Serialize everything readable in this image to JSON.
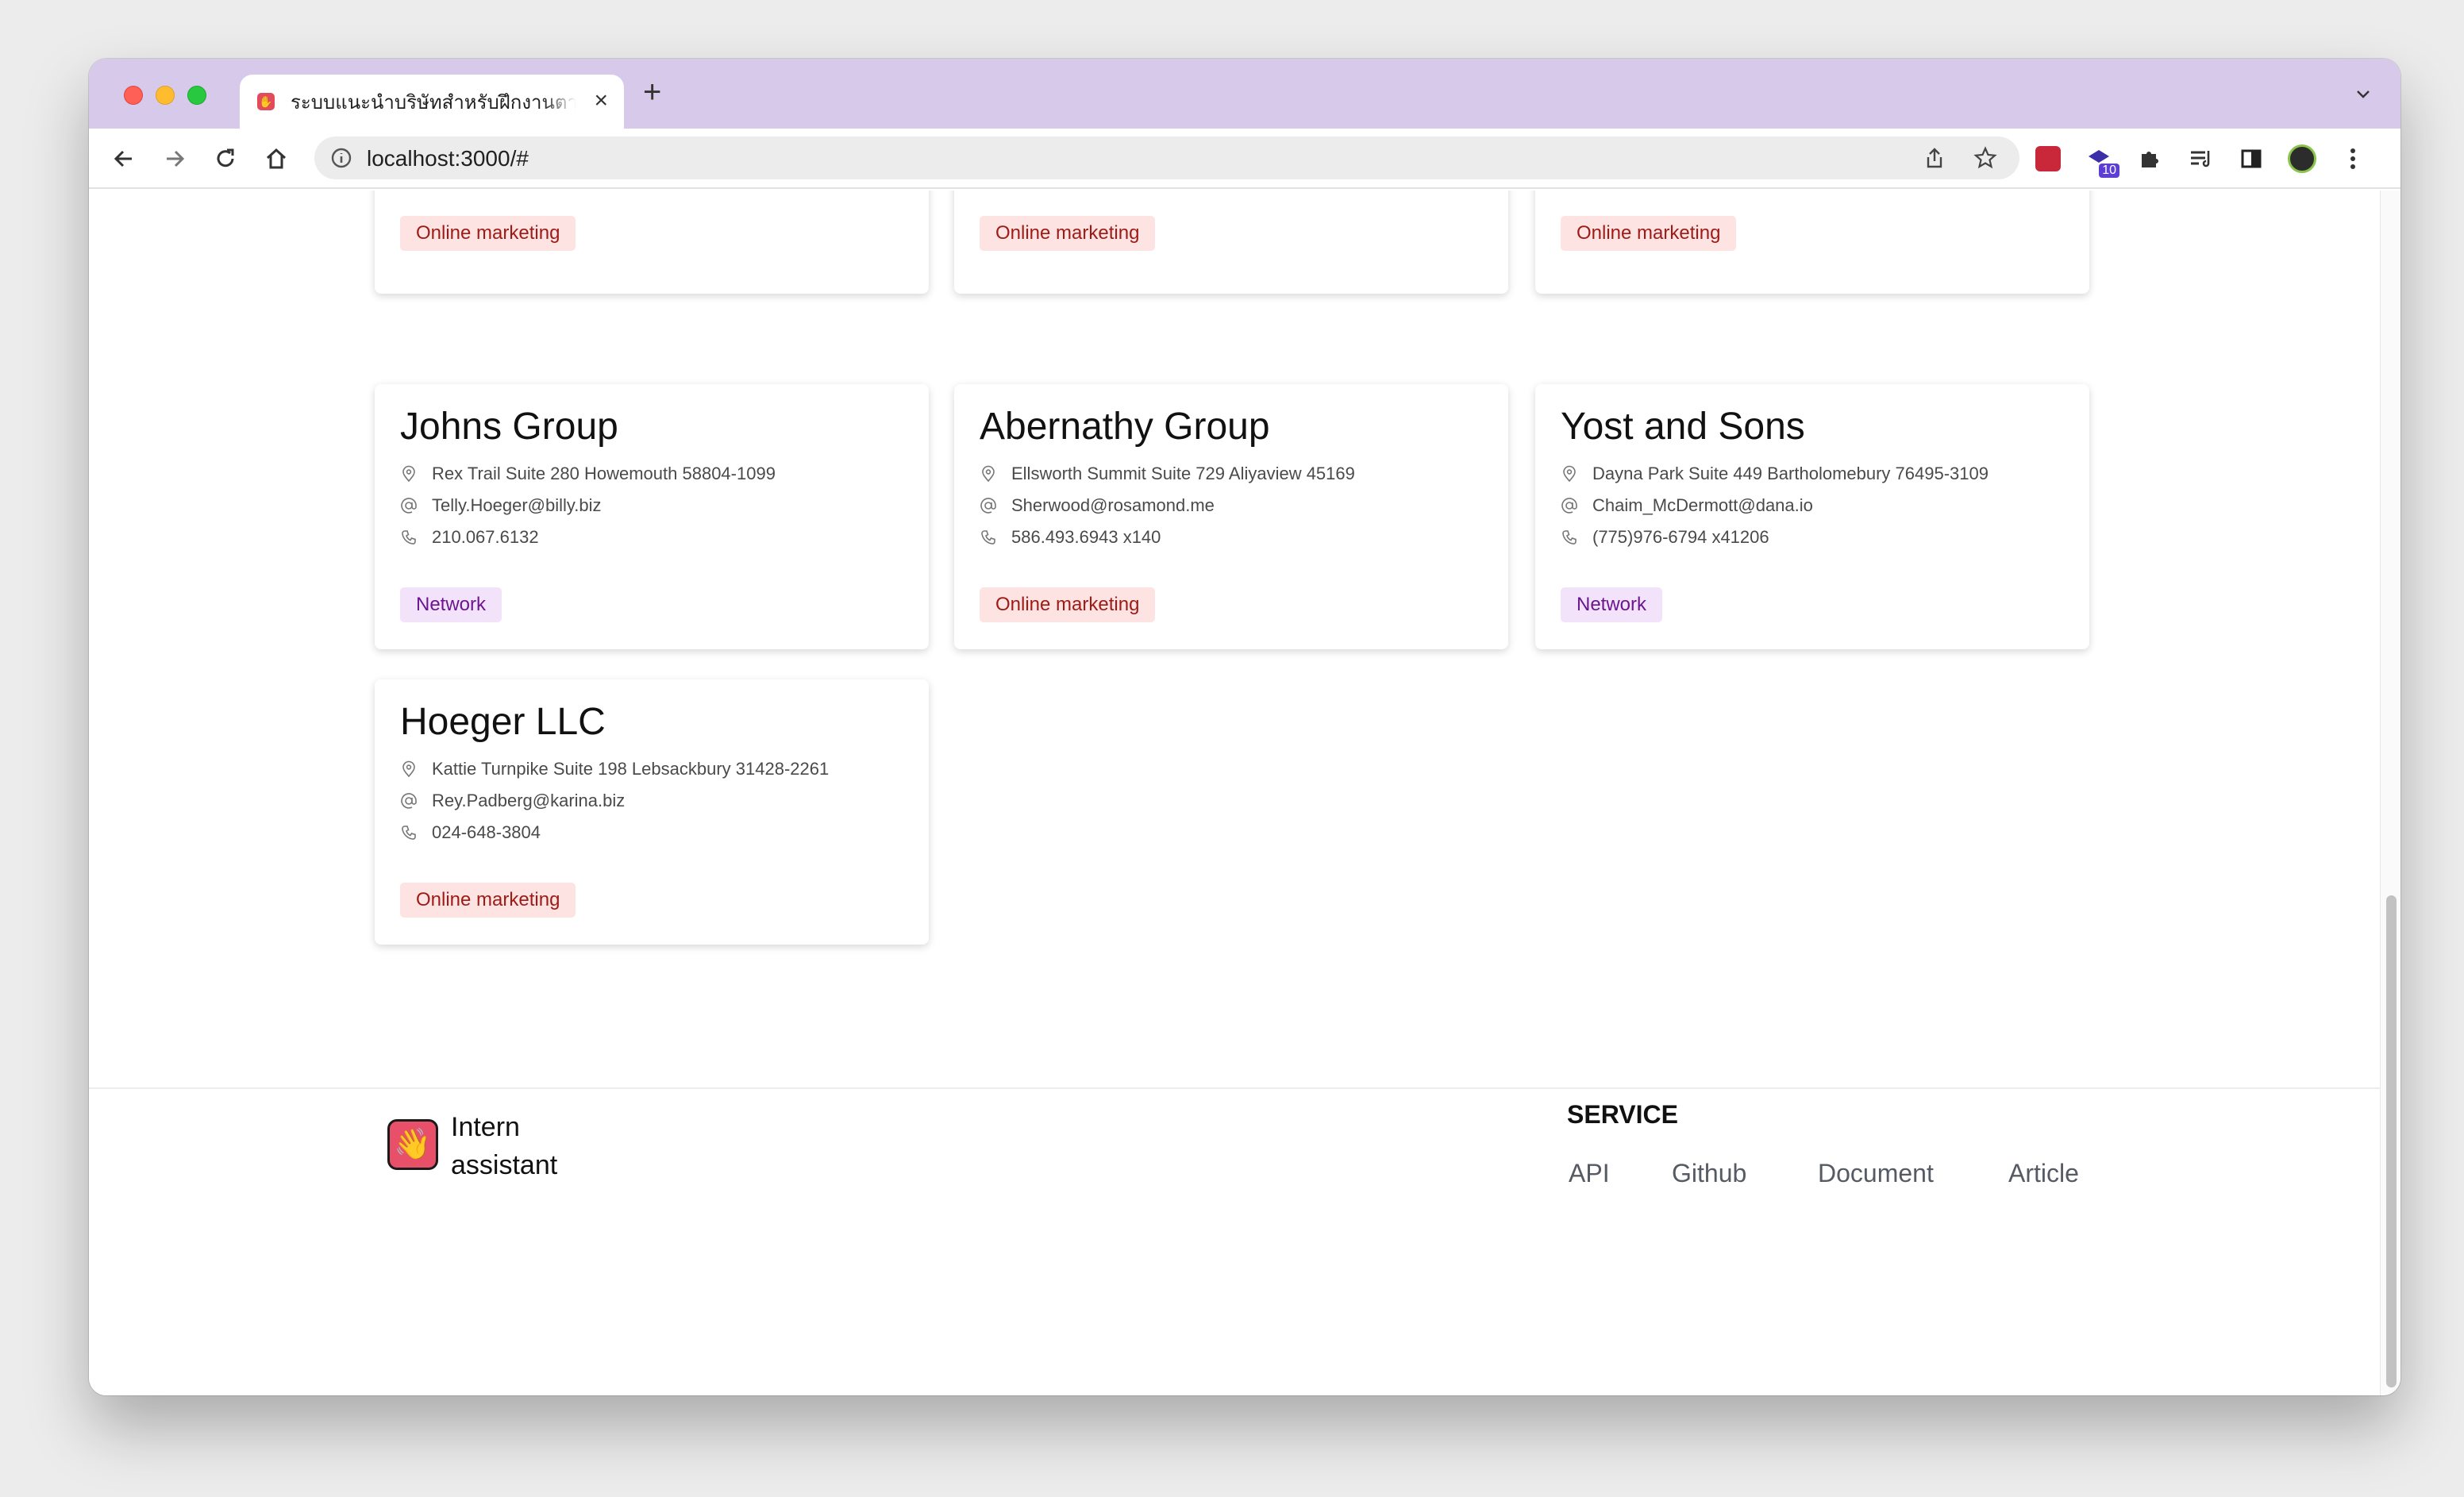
{
  "browser": {
    "tab_title": "ระบบแนะนำบริษัทสำหรับฝึกงานตามความสนใจ",
    "tab_close": "×",
    "new_tab": "+",
    "url": "localhost:3000/#",
    "extension_badge": "10"
  },
  "top_row_tags": [
    "Online marketing",
    "Online marketing",
    "Online marketing"
  ],
  "companies": [
    {
      "name": "Johns Group",
      "address": "Rex Trail Suite 280 Howemouth 58804-1099",
      "email": "Telly.Hoeger@billy.biz",
      "phone": "210.067.6132",
      "tag": "Network"
    },
    {
      "name": "Abernathy Group",
      "address": "Ellsworth Summit Suite 729 Aliyaview 45169",
      "email": "Sherwood@rosamond.me",
      "phone": "586.493.6943 x140",
      "tag": "Online marketing"
    },
    {
      "name": "Yost and Sons",
      "address": "Dayna Park Suite 449 Bartholomebury 76495-3109",
      "email": "Chaim_McDermott@dana.io",
      "phone": "(775)976-6794 x41206",
      "tag": "Network"
    },
    {
      "name": "Hoeger LLC",
      "address": "Kattie Turnpike Suite 198 Lebsackbury 31428-2261",
      "email": "Rey.Padberg@karina.biz",
      "phone": "024-648-3804",
      "tag": "Online marketing"
    }
  ],
  "footer": {
    "logo_line1": "Intern",
    "logo_line2": "assistant",
    "service_heading": "SERVICE",
    "links": [
      "API",
      "Github",
      "Document",
      "Article"
    ]
  },
  "colors": {
    "tab_strip": "#d6c9ea",
    "tag_marketing_bg": "#fde3e1",
    "tag_marketing_text": "#9e1a17",
    "tag_network_bg": "#f3e3fa",
    "tag_network_text": "#6b1690",
    "logo_bg": "#e8506a"
  },
  "icons": {
    "address": "location-pin-icon",
    "email": "at-sign-icon",
    "phone": "phone-icon",
    "logo": "waving-hand-icon"
  }
}
